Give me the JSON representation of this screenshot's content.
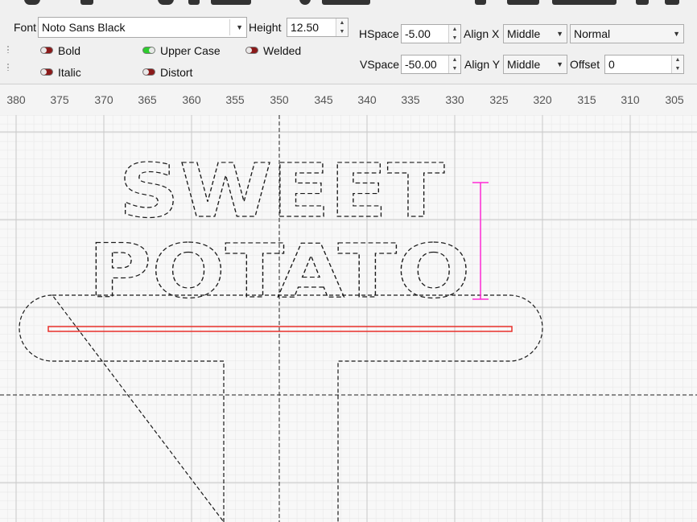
{
  "toolbar": {
    "font_label": "Font",
    "font_value": "Noto Sans Black",
    "height_label": "Height",
    "height_value": "12.50",
    "hspace_label": "HSpace",
    "hspace_value": "-5.00",
    "vspace_label": "VSpace",
    "vspace_value": "-50.00",
    "alignx_label": "Align X",
    "alignx_value": "Middle",
    "aligny_label": "Align Y",
    "aligny_value": "Middle",
    "mode_value": "Normal",
    "offset_label": "Offset",
    "offset_value": "0",
    "bold_label": "Bold",
    "bold_on": false,
    "italic_label": "Italic",
    "italic_on": false,
    "uppercase_label": "Upper Case",
    "uppercase_on": true,
    "distort_label": "Distort",
    "distort_on": false,
    "welded_label": "Welded",
    "welded_on": false
  },
  "ruler": {
    "ticks": [
      "380",
      "375",
      "370",
      "365",
      "360",
      "355",
      "350",
      "345",
      "340",
      "335",
      "330",
      "325",
      "320",
      "315",
      "310",
      "305"
    ]
  },
  "canvas": {
    "text_line1": "SWEET",
    "text_line2": "POTATO",
    "colors": {
      "outline": "#000000",
      "selected_slot": "#e8302a",
      "height_indicator": "#ff2bd6",
      "grid_minor": "#e6e6e6",
      "grid_major": "#c8c8c8"
    }
  }
}
